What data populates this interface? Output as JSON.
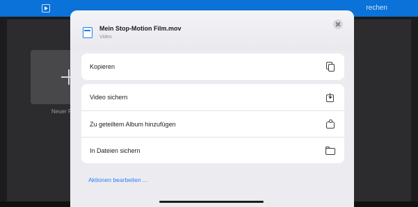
{
  "background_app": {
    "top_bar_right_text": "rechen",
    "new_tile_label": "Neuer F"
  },
  "share_sheet": {
    "file": {
      "title": "Mein Stop-Motion Film.mov",
      "subtitle": "Video",
      "icon": "file-icon"
    },
    "groups": [
      [
        {
          "label": "Kopieren",
          "icon": "copy-icon"
        }
      ],
      [
        {
          "label": "Video sichern",
          "icon": "save-to-device-icon"
        },
        {
          "label": "Zu geteiltem Album hinzufügen",
          "icon": "shared-album-icon"
        },
        {
          "label": "In Dateien sichern",
          "icon": "folder-icon"
        }
      ]
    ],
    "edit_actions_label": "Aktionen bearbeiten ..."
  },
  "colors": {
    "accent": "#2e7cf6",
    "top_bar": "#0a72d8"
  }
}
